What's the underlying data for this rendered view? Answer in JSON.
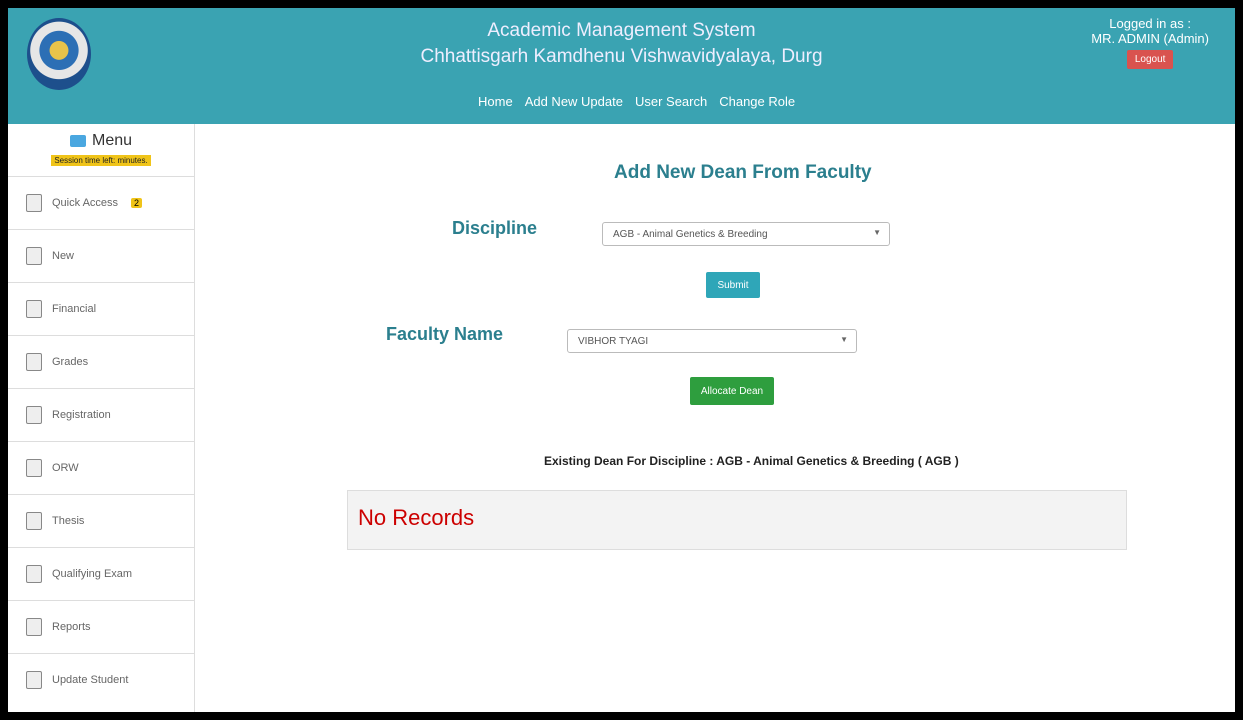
{
  "header": {
    "title_line1": "Academic Management System",
    "title_line2": "Chhattisgarh Kamdhenu Vishwavidyalaya, Durg",
    "nav": [
      "Home",
      "Add New Update",
      "User Search",
      "Change Role"
    ],
    "logged_in_label": "Logged in as :",
    "logged_in_user": "MR. ADMIN (Admin)",
    "logout_label": "Logout"
  },
  "sidebar": {
    "menu_label": "Menu",
    "session_text": "Session time left: minutes.",
    "items": [
      {
        "label": "Quick Access",
        "badge": "2",
        "icon": "quick-access-icon"
      },
      {
        "label": "New",
        "icon": "new-file-icon"
      },
      {
        "label": "Financial",
        "icon": "money-bag-icon"
      },
      {
        "label": "Grades",
        "icon": "grid-icon"
      },
      {
        "label": "Registration",
        "icon": "user-icon"
      },
      {
        "label": "ORW",
        "icon": "grid-icon"
      },
      {
        "label": "Thesis",
        "icon": "grid-icon"
      },
      {
        "label": "Qualifying Exam",
        "icon": "document-icon"
      },
      {
        "label": "Reports",
        "icon": "report-icon"
      },
      {
        "label": "Update Student",
        "icon": "update-icon"
      }
    ]
  },
  "main": {
    "page_title": "Add New Dean From Faculty",
    "discipline_label": "Discipline",
    "discipline_value": "AGB - Animal Genetics & Breeding",
    "submit_label": "Submit",
    "faculty_label": "Faculty Name",
    "faculty_value": "VIBHOR TYAGI",
    "allocate_label": "Allocate Dean",
    "existing_text": "Existing Dean For Discipline : AGB - Animal Genetics & Breeding ( AGB )",
    "no_records": "No Records"
  },
  "colors": {
    "header_bg": "#3aa3b2",
    "heading": "#2b7f8e",
    "submit_btn": "#2fa6b8",
    "allocate_btn": "#2e9e3e",
    "logout_btn": "#d9534f",
    "no_records": "#cc0000"
  }
}
